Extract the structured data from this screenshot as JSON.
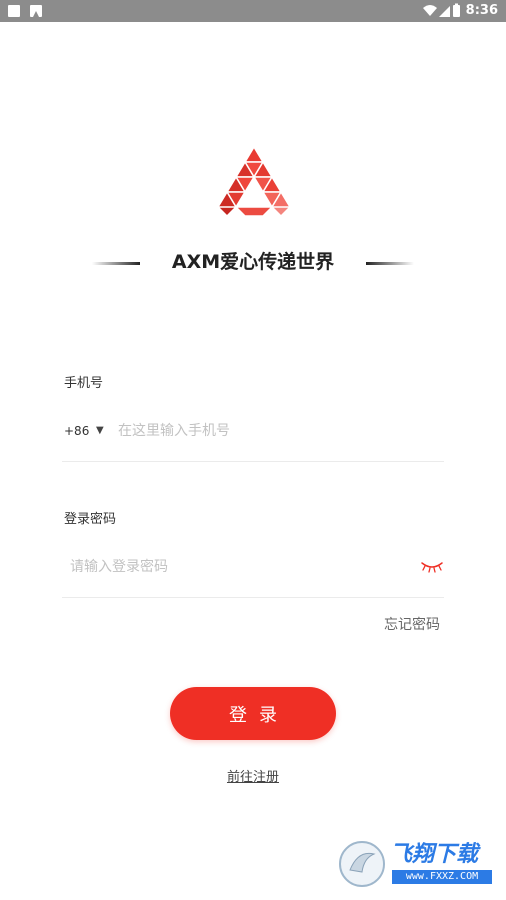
{
  "status_bar": {
    "time": "8:36",
    "icons": [
      "wifi-icon",
      "signal-icon",
      "battery-icon"
    ]
  },
  "brand": {
    "title": "AXM爱心传递世界",
    "accent_color": "#ef2f25"
  },
  "phone": {
    "label": "手机号",
    "country_code": "+86",
    "dropdown_symbol": "▼",
    "placeholder": "在这里输入手机号",
    "value": ""
  },
  "password": {
    "label": "登录密码",
    "placeholder": "请输入登录密码",
    "value": ""
  },
  "forgot_password": "忘记密码",
  "login_button": "登录",
  "register_link": "前往注册",
  "watermark": {
    "text": "飞翔下载",
    "url": "www.FXXZ.COM"
  }
}
